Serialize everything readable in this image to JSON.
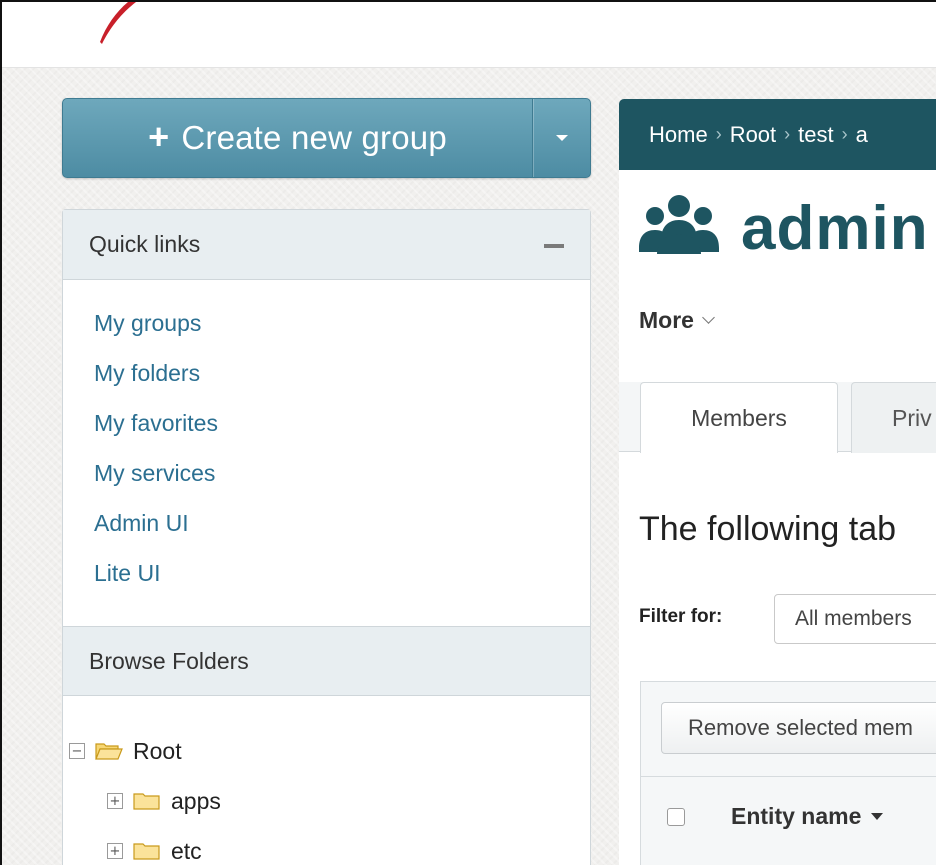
{
  "create_group": {
    "label": "Create new group"
  },
  "quick_links": {
    "title": "Quick links",
    "items": [
      {
        "label": "My groups"
      },
      {
        "label": "My folders"
      },
      {
        "label": "My favorites"
      },
      {
        "label": "My services"
      },
      {
        "label": "Admin UI"
      },
      {
        "label": "Lite UI"
      }
    ]
  },
  "browse_folders": {
    "title": "Browse Folders",
    "tree": [
      {
        "label": "Root",
        "toggle": "−",
        "children": [
          {
            "label": "apps",
            "toggle": "+"
          },
          {
            "label": "etc",
            "toggle": "+"
          }
        ]
      }
    ]
  },
  "breadcrumb": {
    "items": [
      "Home",
      "Root",
      "test",
      "a"
    ],
    "separator": "›"
  },
  "group": {
    "name": "admin",
    "more_label": "More"
  },
  "tabs": [
    {
      "label": "Members",
      "active": true
    },
    {
      "label": "Priv",
      "active": false
    }
  ],
  "main": {
    "intro_text": "The following tab",
    "filter_label": "Filter for:",
    "filter_value": "All members",
    "remove_button": "Remove selected mem",
    "column_entity_name": "Entity name"
  },
  "colors": {
    "accent": "#1e5561",
    "button": "#5b99ae",
    "link": "#2b6f91",
    "logo_red": "#c8202a"
  }
}
